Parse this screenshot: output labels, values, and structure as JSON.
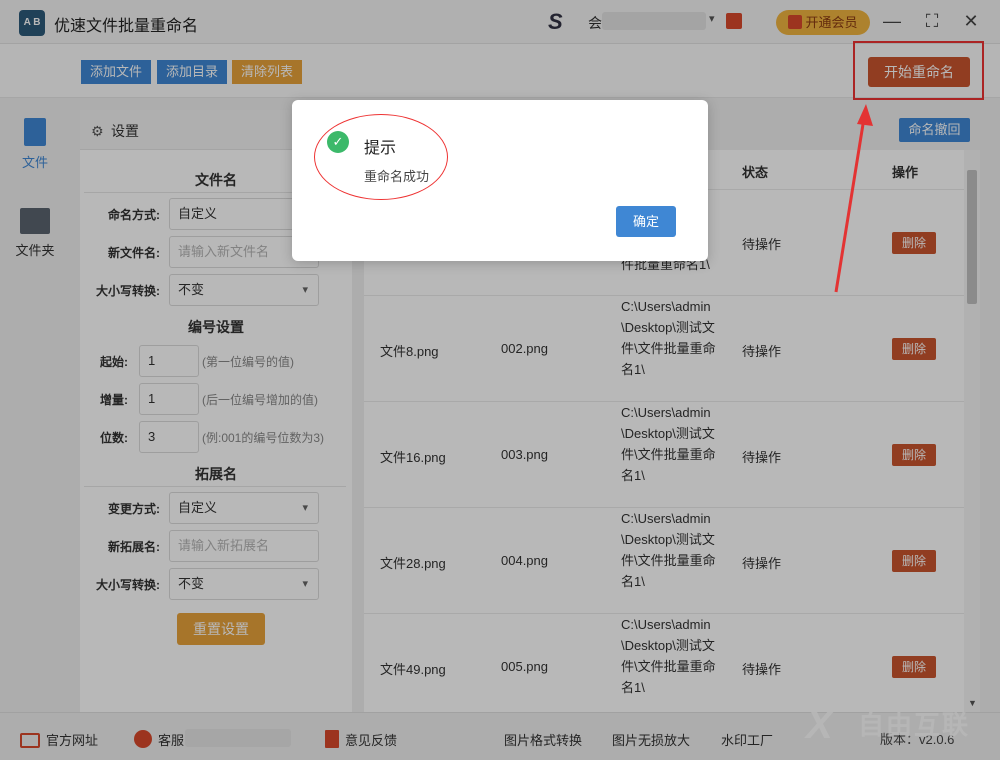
{
  "app": {
    "logo_text": "A B",
    "title": "优速文件批量重命名",
    "account_prefix": "会",
    "vip_label": "开通会员",
    "min_icon": "—",
    "max_icon": "⛶",
    "close_icon": "✕"
  },
  "toolbar": {
    "add_file": "添加文件",
    "add_dir": "添加目录",
    "clear_list": "清除列表",
    "start_rename": "开始重命名"
  },
  "sidebar": {
    "items": [
      {
        "label": "文件",
        "icon": "file-icon"
      },
      {
        "label": "文件夹",
        "icon": "folder-icon"
      }
    ]
  },
  "settings": {
    "header": "设置",
    "filename_section": "文件名",
    "naming_label": "命名方式:",
    "naming_value": "自定义",
    "newname_label": "新文件名:",
    "newname_placeholder": "请输入新文件名",
    "case_label": "大小写转换:",
    "case_value": "不变",
    "numbering_section": "编号设置",
    "start_label": "起始:",
    "start_value": "1",
    "start_hint": "(第一位编号的值)",
    "increment_label": "增量:",
    "increment_value": "1",
    "increment_hint": "(后一位编号增加的值)",
    "digits_label": "位数:",
    "digits_value": "3",
    "digits_hint": "(例:001的编号位数为3)",
    "ext_section": "拓展名",
    "change_label": "变更方式:",
    "change_value": "自定义",
    "newext_label": "新拓展名:",
    "newext_placeholder": "请输入新拓展名",
    "ext_case_label": "大小写转换:",
    "ext_case_value": "不变",
    "reset_button": "重置设置"
  },
  "table": {
    "undo_button": "命名撤回",
    "headers": {
      "status": "状态",
      "action": "操作"
    },
    "rows": [
      {
        "original": "",
        "new_name": "",
        "path": "件批量重命名1\\",
        "status": "待操作",
        "action": "删除"
      },
      {
        "original": "文件8.png",
        "new_name": "002.png",
        "path": "C:\\Users\\admin\\Desktop\\测试文件\\文件批量重命名1\\",
        "status": "待操作",
        "action": "删除"
      },
      {
        "original": "文件16.png",
        "new_name": "003.png",
        "path": "C:\\Users\\admin\\Desktop\\测试文件\\文件批量重命名1\\",
        "status": "待操作",
        "action": "删除"
      },
      {
        "original": "文件28.png",
        "new_name": "004.png",
        "path": "C:\\Users\\admin\\Desktop\\测试文件\\文件批量重命名1\\",
        "status": "待操作",
        "action": "删除"
      },
      {
        "original": "文件49.png",
        "new_name": "005.png",
        "path": "C:\\Users\\admin\\Desktop\\测试文件\\文件批量重命名1\\",
        "status": "待操作",
        "action": "删除"
      }
    ]
  },
  "dialog": {
    "title": "提示",
    "message": "重命名成功",
    "ok_button": "确定"
  },
  "footer": {
    "website": "官方网址",
    "support": "客服",
    "feedback": "意见反馈",
    "link_convert": "图片格式转换",
    "link_enlarge": "图片无损放大",
    "link_watermark": "水印工厂",
    "version": "版本：v2.0.6",
    "watermark_text": "自由互联"
  },
  "colors": {
    "accent_blue": "#3f87d4",
    "accent_orange": "#e8a23b",
    "danger_red": "#c9552e",
    "success_green": "#3cb96a",
    "annotation_red": "#e33333"
  }
}
